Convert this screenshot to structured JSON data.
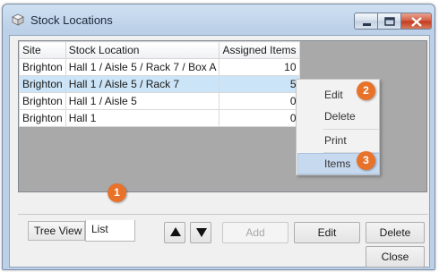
{
  "window": {
    "title": "Stock Locations",
    "icon": "box-icon",
    "controls": [
      "minimize-icon",
      "maximize-icon",
      "close-icon"
    ]
  },
  "grid": {
    "columns": [
      "Site",
      "Stock Location",
      "Assigned Items"
    ],
    "rows": [
      {
        "site": "Brighton",
        "location": "Hall 1 / Aisle 5 / Rack 7 / Box A",
        "items": "10",
        "selected": false
      },
      {
        "site": "Brighton",
        "location": "Hall 1 / Aisle 5 / Rack 7",
        "items": "5",
        "selected": true
      },
      {
        "site": "Brighton",
        "location": "Hall 1 / Aisle 5",
        "items": "0",
        "selected": false
      },
      {
        "site": "Brighton",
        "location": "Hall 1",
        "items": "0",
        "selected": false
      }
    ]
  },
  "context_menu": {
    "items": [
      "Edit",
      "Delete",
      "Print",
      "Items"
    ],
    "highlighted": "Items"
  },
  "tabs": {
    "tree": "Tree View",
    "list": "List",
    "active": "List"
  },
  "buttons": {
    "up": "up-arrow-icon",
    "down": "down-arrow-icon",
    "add": "Add",
    "edit": "Edit",
    "delete": "Delete",
    "close": "Close"
  },
  "callouts": [
    "1",
    "2",
    "3"
  ],
  "colors": {
    "selection": "#cce4f7",
    "menu_highlight": "#c7d9ee",
    "callout": "#e8722a",
    "close_button": "#c23a1e"
  }
}
